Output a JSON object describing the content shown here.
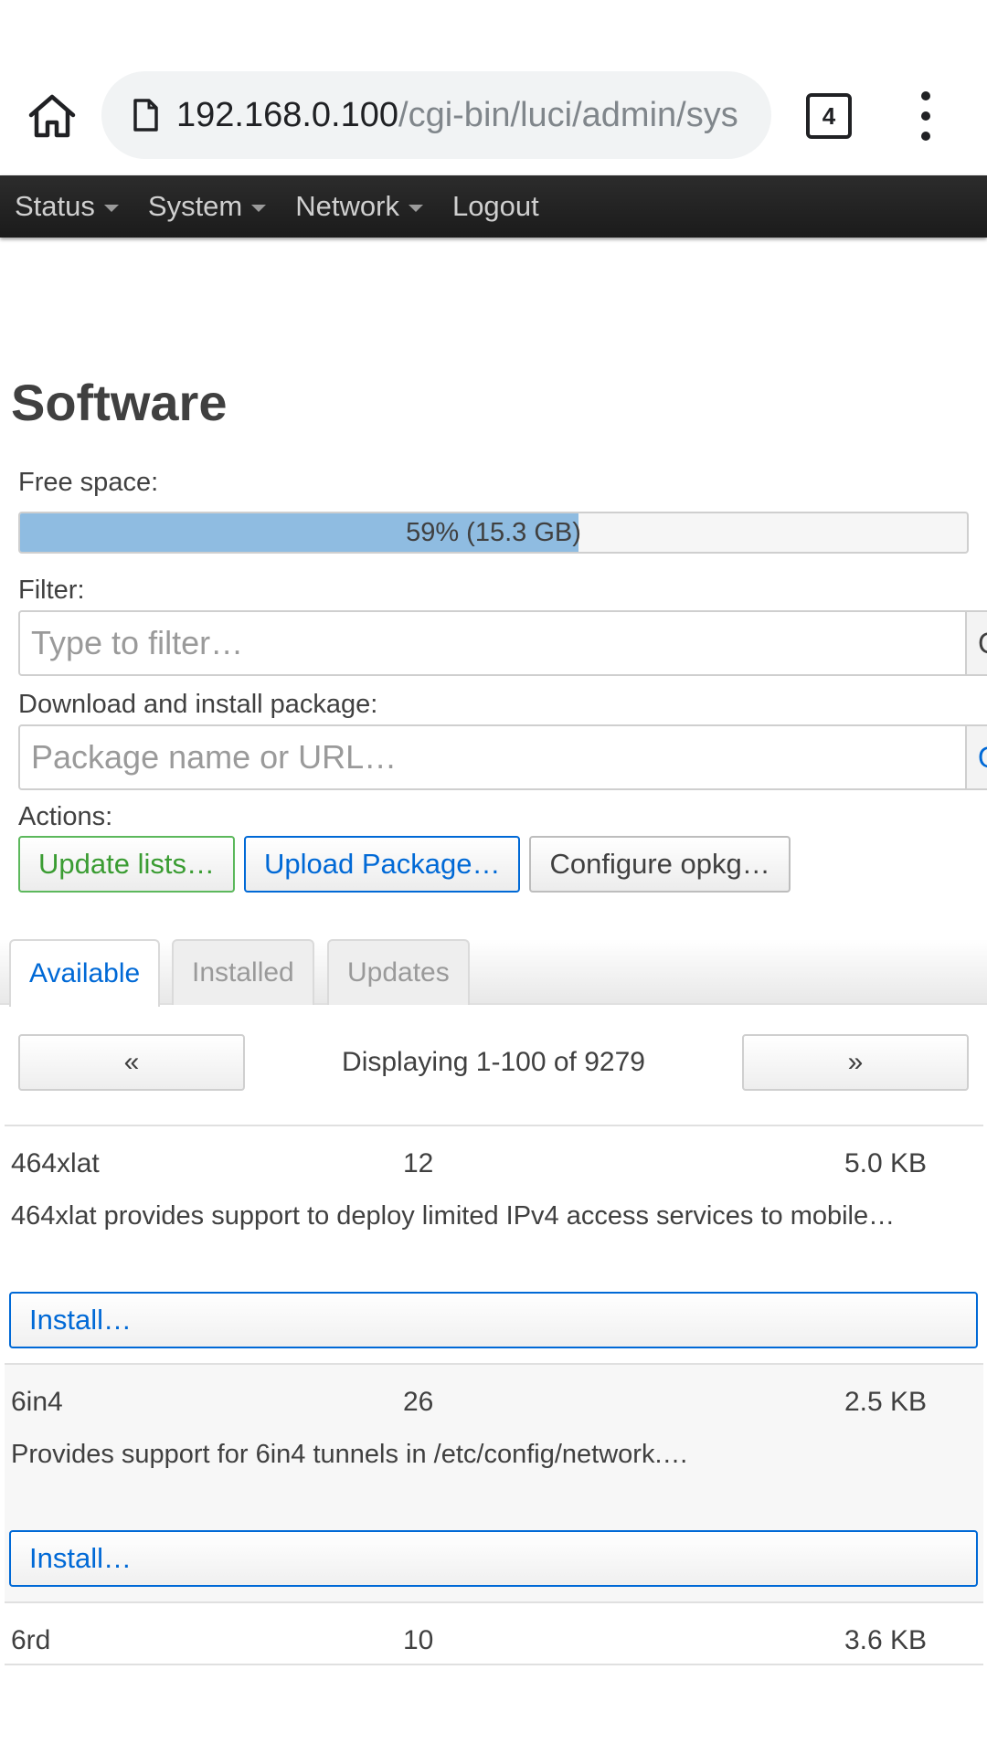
{
  "browser": {
    "url_host": "192.168.0.100",
    "url_path": "/cgi-bin/luci/admin/sys",
    "tab_count": "4"
  },
  "nav": {
    "items": [
      {
        "label": "Status",
        "dropdown": true
      },
      {
        "label": "System",
        "dropdown": true
      },
      {
        "label": "Network",
        "dropdown": true
      },
      {
        "label": "Logout",
        "dropdown": false
      }
    ]
  },
  "page": {
    "title": "Software",
    "free_space_label": "Free space:",
    "free_space_percent": 59,
    "free_space_text": "59% (15.3 GB)",
    "filter_label": "Filter:",
    "filter_placeholder": "Type to filter…",
    "filter_addon": "C",
    "download_label": "Download and install package:",
    "download_placeholder": "Package name or URL…",
    "download_addon": "O",
    "actions_label": "Actions:",
    "actions": {
      "update": "Update lists…",
      "upload": "Upload Package…",
      "configure": "Configure opkg…"
    }
  },
  "tabs": [
    "Available",
    "Installed",
    "Updates"
  ],
  "pager": {
    "prev": "«",
    "next": "»",
    "text": "Displaying 1-100 of 9279"
  },
  "packages": [
    {
      "name": "464xlat",
      "version": "12",
      "size": "5.0 KB",
      "description": "464xlat provides support to deploy limited IPv4 access services to mobile…",
      "install": "Install…"
    },
    {
      "name": "6in4",
      "version": "26",
      "size": "2.5 KB",
      "description": "Provides support for 6in4 tunnels in /etc/config/network.…",
      "install": "Install…"
    },
    {
      "name": "6rd",
      "version": "10",
      "size": "3.6 KB"
    }
  ],
  "colors": {
    "navbar": "#222222",
    "progress_fill": "#8fbce1",
    "accent_blue": "#0069d6",
    "accent_green": "#3a9c32"
  }
}
